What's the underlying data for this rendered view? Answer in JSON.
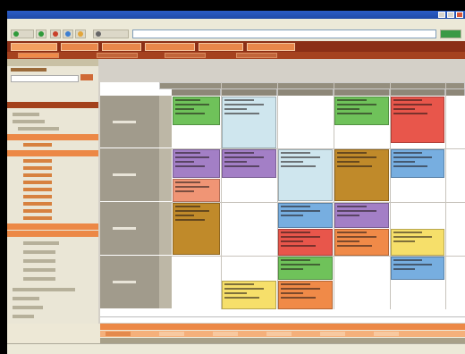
{
  "window": {
    "title": ""
  },
  "menu": [
    "",
    "",
    "",
    "",
    "",
    ""
  ],
  "toolbar": {
    "address": ""
  },
  "tabs": [
    {
      "label": "",
      "active": true
    },
    {
      "label": ""
    },
    {
      "label": ""
    },
    {
      "label": ""
    },
    {
      "label": ""
    },
    {
      "label": ""
    }
  ],
  "subtabs": [
    "",
    "",
    "",
    "",
    ""
  ],
  "sidebar": {
    "header": "",
    "items": [
      "",
      "",
      "",
      "",
      "",
      "",
      "",
      "",
      "",
      "",
      "",
      "",
      "",
      "",
      "",
      "",
      "",
      "",
      "",
      "",
      "",
      "",
      "",
      "",
      ""
    ]
  },
  "timetable": {
    "days": [
      "",
      "",
      "",
      "",
      "",
      ""
    ],
    "week_label": "",
    "rows": [
      "",
      "",
      "",
      ""
    ],
    "colors": {
      "green": "#6fc25a",
      "lightblue": "#cfe6ee",
      "red": "#e8564b",
      "purple": "#a37fc6",
      "blue": "#77aee0",
      "orange": "#f08a48",
      "brown": "#c08a2a",
      "yellow": "#f6df6a",
      "salmon": "#f09575"
    }
  },
  "status": {
    "text": ""
  }
}
